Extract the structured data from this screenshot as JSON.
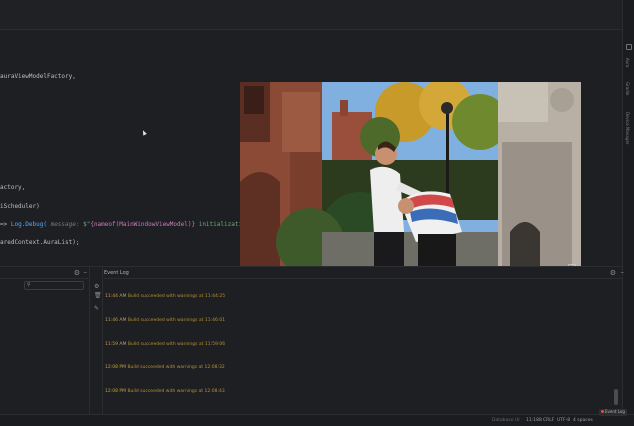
{
  "editor": {
    "lines": [
      "auraViewModelFactory,",
      "actory,",
      "iScheduler)",
      "ar",
      "aredContext.AuraList);"
    ],
    "log_line": {
      "prefix": "=> ",
      "call": "Log.Debug(",
      "hint": " message: ",
      "str_start": "$\"",
      "tmpl": "{nameof(MainWindowViewModel)}",
      "str_end": " initialization"
    }
  },
  "event_log": {
    "title": "Event Log",
    "entries": [
      {
        "time": "11:44 AM",
        "message": "Build succeeded with warnings at 11:44:25"
      },
      {
        "time": "11:46 AM",
        "message": "Build succeeded with warnings at 11:46:01"
      },
      {
        "time": "11:59 AM",
        "message": "Build succeeded with warnings at 11:59:06"
      },
      {
        "time": "12:08 PM",
        "message": "Build succeeded with warnings at 12:08:32"
      },
      {
        "time": "12:08 PM",
        "message": "Build succeeded with warnings at 12:08:43"
      }
    ]
  },
  "right_stripe": {
    "labels": [
      "Aura",
      "Gradle",
      "Device Manager"
    ]
  },
  "status_bar": {
    "items": [
      "Database UI",
      "11:188",
      "CRLF",
      "UTF-8",
      "4 spaces"
    ],
    "badge": "Event Log"
  },
  "colors": {
    "background": "#1e1f22",
    "log_text": "#c8a042",
    "accent_error": "#e05252"
  }
}
